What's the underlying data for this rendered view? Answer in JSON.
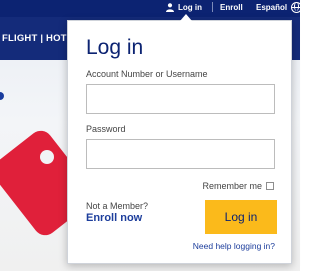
{
  "header": {
    "login_label": "Log in",
    "enroll_label": "Enroll",
    "language_label": "Español",
    "nav_text": "FLIGHT | HOTEL"
  },
  "login_panel": {
    "title": "Log in",
    "username_label": "Account Number or Username",
    "username_value": "",
    "password_label": "Password",
    "password_value": "",
    "remember_label": "Remember me",
    "remember_checked": false,
    "not_member_text": "Not a Member?",
    "enroll_now_label": "Enroll now",
    "login_button_label": "Log in",
    "help_link_label": "Need help logging in?"
  },
  "colors": {
    "brand_navy": "#0c2372",
    "button_yellow": "#fbba1b",
    "link_blue": "#1d3e9c",
    "accent_red": "#e0203a"
  },
  "icons": {
    "login": "user-icon",
    "language": "globe-icon"
  }
}
